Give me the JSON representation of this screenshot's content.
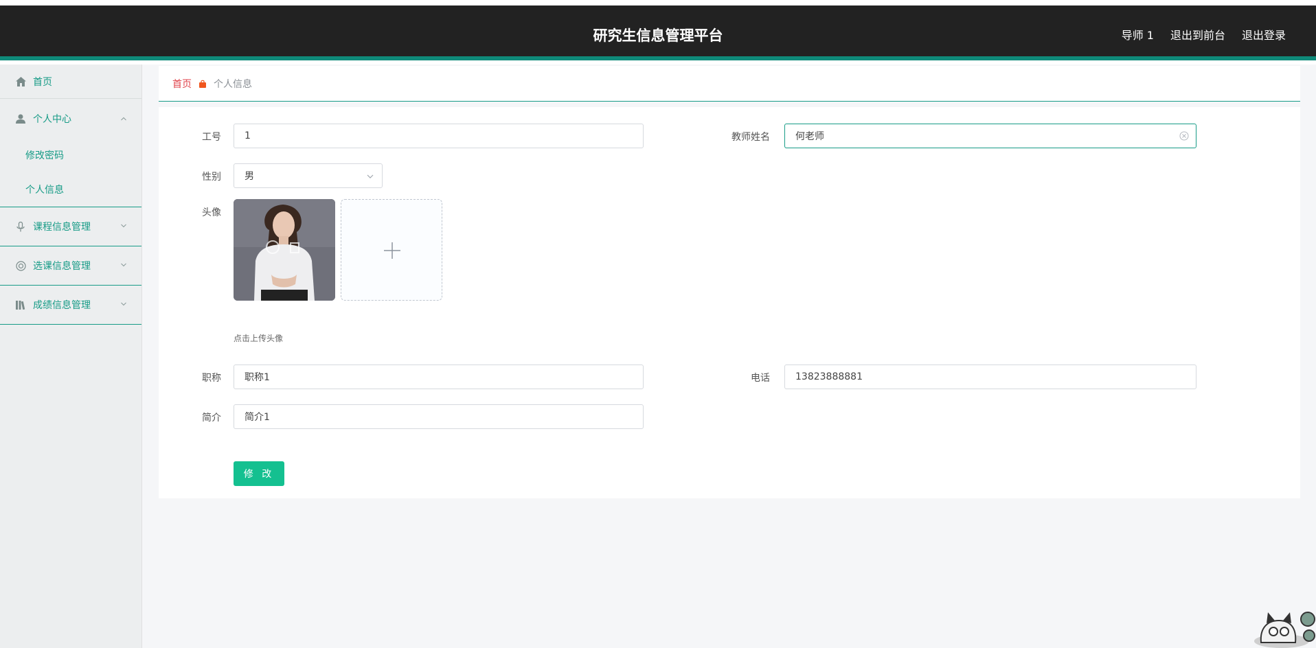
{
  "header": {
    "title": "研究生信息管理平台",
    "user": "导师 1",
    "to_front": "退出到前台",
    "logout": "退出登录"
  },
  "sidebar": {
    "home": "首页",
    "personal_center": "个人中心",
    "change_password": "修改密码",
    "personal_info": "个人信息",
    "course_mgmt": "课程信息管理",
    "selection_mgmt": "选课信息管理",
    "grade_mgmt": "成绩信息管理"
  },
  "breadcrumb": {
    "home": "首页",
    "current": "个人信息"
  },
  "form": {
    "work_id_label": "工号",
    "work_id_value": "1",
    "teacher_name_label": "教师姓名",
    "teacher_name_value": "何老师",
    "gender_label": "性别",
    "gender_value": "男",
    "avatar_label": "头像",
    "avatar_tip": "点击上传头像",
    "title_label": "职称",
    "title_value": "职称1",
    "phone_label": "电话",
    "phone_value": "13823888881",
    "intro_label": "简介",
    "intro_value": "简介1",
    "submit_label": "修 改"
  },
  "colors": {
    "accent": "#169b86",
    "header_bg": "#222222",
    "button": "#14c090"
  }
}
